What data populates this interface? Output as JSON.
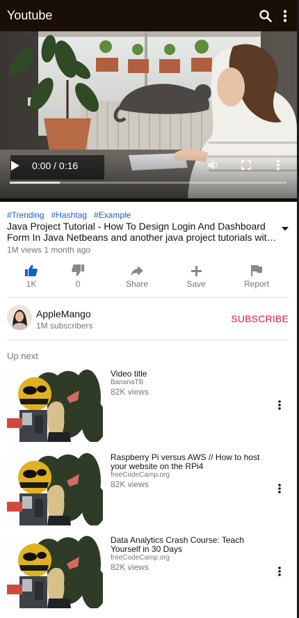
{
  "appbar": {
    "title": "Youtube",
    "icons": [
      "search-icon",
      "more-vert-icon"
    ]
  },
  "player": {
    "time": "0:00 / 0:16",
    "progress_fraction": 0.0,
    "buffered_fraction": 0.18
  },
  "video": {
    "tags": [
      "#Trending",
      "#Hashtag",
      "#Example"
    ],
    "title_line1": "Java Project Tutorial - How To Design Login And Dashboard",
    "title_line2": "Form In Java Netbeans and another java project tutorials wit…",
    "meta": "1M views 1 month ago"
  },
  "actions": [
    {
      "icon": "thumbs-up-icon",
      "label": "1K"
    },
    {
      "icon": "thumbs-down-icon",
      "label": "0"
    },
    {
      "icon": "share-icon",
      "label": "Share"
    },
    {
      "icon": "add-icon",
      "label": "Save"
    },
    {
      "icon": "flag-icon",
      "label": "Report"
    }
  ],
  "channel": {
    "name": "AppleMango",
    "subscribers": "1M subscribers",
    "subscribe_label": "SUBSCRIBE"
  },
  "upnext": {
    "heading": "Up next",
    "items": [
      {
        "title": "Video title",
        "channel": "BananaTB",
        "views": "82K views"
      },
      {
        "title": "Raspberry Pi versus AWS // How to host your website on the RPi4",
        "channel": "freeCodeCamp.org",
        "views": "82K views"
      },
      {
        "title": "Data Analytics Crash Course: Teach Yourself in 30 Days",
        "channel": "freeCodeCamp.org",
        "views": "82K views"
      }
    ]
  },
  "colors": {
    "appbar": "#1a0f06",
    "link": "#1a5ec7",
    "subscribe": "#d81b3a",
    "like_active": "#1a5ec7",
    "muted": "#757575"
  }
}
